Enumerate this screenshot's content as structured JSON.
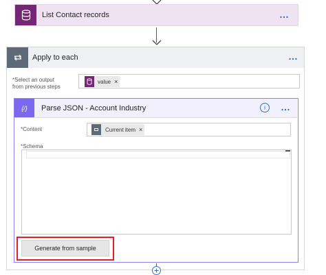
{
  "list_action": {
    "title": "List Contact records",
    "more_label": "…"
  },
  "apply_each": {
    "title": "Apply to each",
    "more_label": "…",
    "select_label_line1": "Select an output",
    "select_label_line2": "from previous steps",
    "required_mark": "*",
    "token_label": "value",
    "token_remove": "×"
  },
  "parse_json": {
    "icon_label": "{/}",
    "title": "Parse JSON - Account Industry",
    "info_label": "i",
    "more_label": "…",
    "content_label": "Content",
    "content_token": "Current item",
    "content_token_remove": "×",
    "schema_label": "Schema",
    "generate_label": "Generate from sample"
  },
  "colors": {
    "dataverse_purple": "#742774",
    "loop_grey": "#5e6a78",
    "parse_violet": "#7b68ee",
    "link_blue": "#2f6fd0",
    "highlight_red": "#e31e24"
  },
  "icons": [
    "dataverse-icon",
    "loop-icon",
    "braces-icon",
    "info-icon",
    "arrow-down-icon",
    "add-step-icon"
  ]
}
